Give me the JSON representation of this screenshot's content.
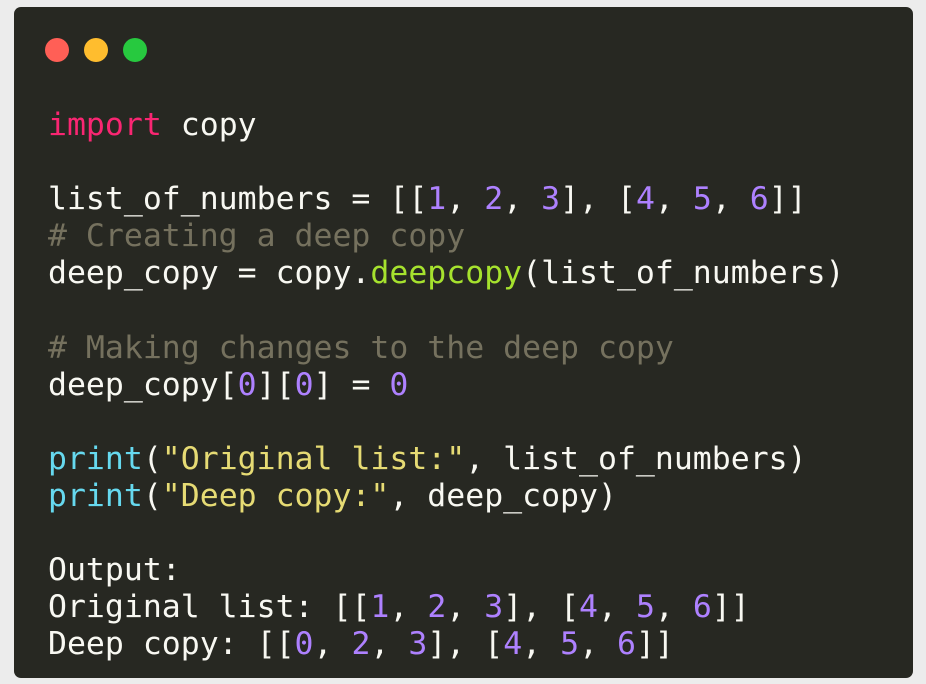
{
  "window": {
    "dots": [
      {
        "name": "close-dot",
        "color": "#ff5f56"
      },
      {
        "name": "minimize-dot",
        "color": "#ffbd2e"
      },
      {
        "name": "maximize-dot",
        "color": "#27c93f"
      }
    ]
  },
  "colors": {
    "background": "#272822",
    "text": "#f8f8f2",
    "keyword": "#f92672",
    "number": "#ae81ff",
    "comment": "#75715e",
    "function": "#a6e22e",
    "builtin": "#66d9ef",
    "string": "#e6db74"
  },
  "code": {
    "line1": {
      "kw": "import",
      "rest": " copy"
    },
    "line3": {
      "a": "list_of_numbers = [[",
      "n1": "1",
      "s1": ", ",
      "n2": "2",
      "s2": ", ",
      "n3": "3",
      "s3": "], [",
      "n4": "4",
      "s4": ", ",
      "n5": "5",
      "s5": ", ",
      "n6": "6",
      "end": "]]"
    },
    "line4": {
      "comment": "# Creating a deep copy"
    },
    "line5": {
      "a": "deep_copy = copy.",
      "fn": "deepcopy",
      "b": "(list_of_numbers)"
    },
    "line7": {
      "comment": "# Making changes to the deep copy"
    },
    "line8": {
      "a": "deep_copy[",
      "n1": "0",
      "b": "][",
      "n2": "0",
      "c": "] = ",
      "n3": "0"
    },
    "line10": {
      "bi": "print",
      "a": "(",
      "str": "\"Original list:\"",
      "b": ", list_of_numbers)"
    },
    "line11": {
      "bi": "print",
      "a": "(",
      "str": "\"Deep copy:\"",
      "b": ", deep_copy)"
    },
    "line13": {
      "text": "Output:"
    },
    "line14": {
      "a": "Original list: [[",
      "n1": "1",
      "s1": ", ",
      "n2": "2",
      "s2": ", ",
      "n3": "3",
      "s3": "], [",
      "n4": "4",
      "s4": ", ",
      "n5": "5",
      "s5": ", ",
      "n6": "6",
      "end": "]]"
    },
    "line15": {
      "a": "Deep copy: [[",
      "n1": "0",
      "s1": ", ",
      "n2": "2",
      "s2": ", ",
      "n3": "3",
      "s3": "], [",
      "n4": "4",
      "s4": ", ",
      "n5": "5",
      "s5": ", ",
      "n6": "6",
      "end": "]]"
    }
  }
}
